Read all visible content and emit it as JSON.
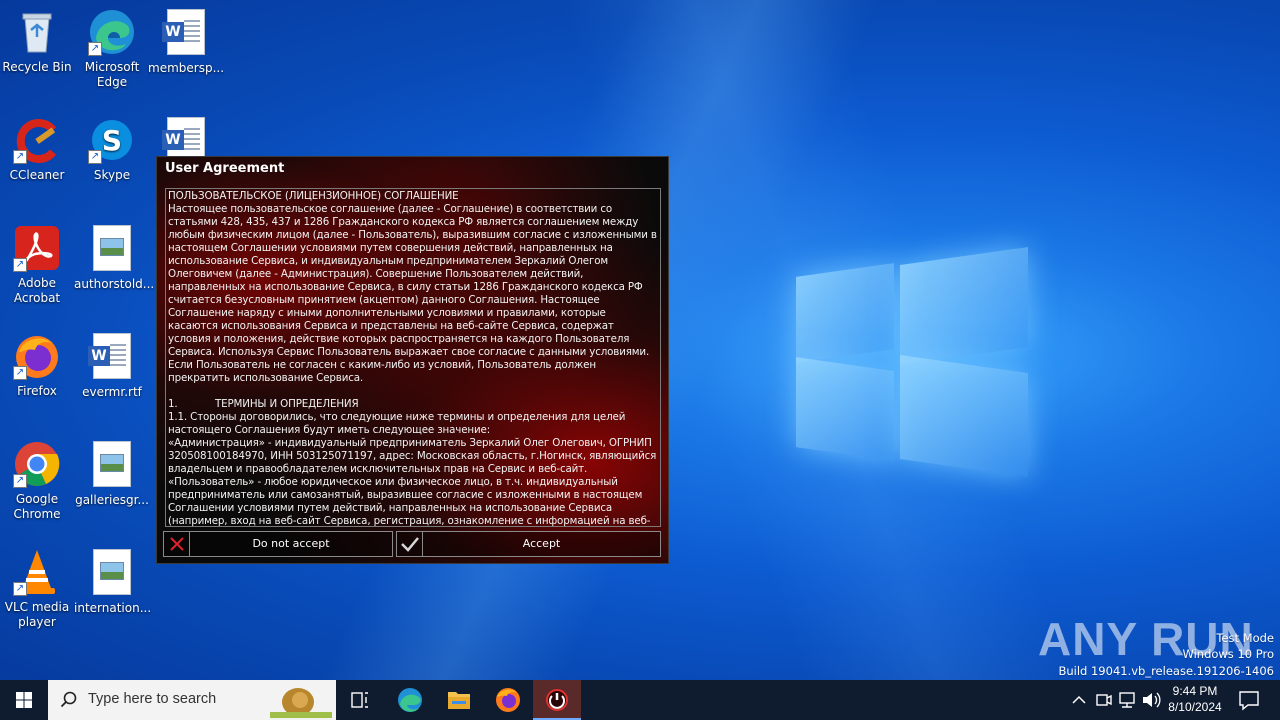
{
  "desktop": {
    "icons": [
      {
        "label": "Recycle Bin",
        "icon": "recycle-bin-icon"
      },
      {
        "label": "Microsoft Edge",
        "icon": "edge-icon"
      },
      {
        "label": "membersp...",
        "icon": "word-doc-icon"
      },
      {
        "label": "CCleaner",
        "icon": "ccleaner-icon"
      },
      {
        "label": "Skype",
        "icon": "skype-icon"
      },
      {
        "label": "Adobe Acrobat",
        "icon": "acrobat-icon"
      },
      {
        "label": "authorstold...",
        "icon": "image-file-icon"
      },
      {
        "label": "Firefox",
        "icon": "firefox-icon"
      },
      {
        "label": "evermr.rtf",
        "icon": "word-doc-icon"
      },
      {
        "label": "Google Chrome",
        "icon": "chrome-icon"
      },
      {
        "label": "galleriesgr...",
        "icon": "image-file-icon"
      },
      {
        "label": "VLC media player",
        "icon": "vlc-icon"
      },
      {
        "label": "internation...",
        "icon": "image-file-icon"
      }
    ]
  },
  "dialog": {
    "title": "User Agreement",
    "paragraphs": [
      "ПОЛЬЗОВАТЕЛЬСКОЕ (ЛИЦЕНЗИОННОЕ) СОГЛАШЕНИЕ",
      "Настоящее пользовательское соглашение (далее - Соглашение) в соответствии со статьями 428, 435, 437 и 1286 Гражданского кодекса РФ является соглашением между любым физическим лицом (далее - Пользователь), выразившим согласие с изложенными в настоящем Соглашении условиями путем совершения действий, направленных на использование Сервиса, и индивидуальным предпринимателем Зеркалий Олегом Олеговичем (далее - Администрация). Совершение Пользователем действий, направленных на использование Сервиса, в силу статьи 1286 Гражданского кодекса РФ считается безусловным принятием (акцептом) данного Соглашения. Настоящее Соглашение наряду с иными дополнительными условиями и правилами, которые касаются использования Сервиса и представлены на веб-сайте Сервиса, содержат условия и положения, действие которых распространяется на каждого Пользователя Сервиса. Используя Сервис Пользователь выражает свое согласие с данными условиями. Если Пользователь не согласен с каким-либо из условий, Пользователь должен прекратить использование Сервиса.",
      "",
      "1.            ТЕРМИНЫ И ОПРЕДЕЛЕНИЯ",
      "1.1. Стороны договорились, что следующие ниже термины и определения для целей настоящего Соглашения будут иметь следующее значение:",
      "«Администрация» - индивидуальный предприниматель Зеркалий Олег Олегович, ОГРНИП 320508100184970, ИНН 503125071197, адрес: Московская область, г.Ногинск, являющийся владельцем и правообладателем исключительных прав на Сервис и веб-сайт.",
      "«Пользователь» - любое юридическое или физическое лицо, в т.ч. индивидуальный предприниматель или самозанятый, выразившее согласие с изложенными в настоящем Соглашении условиями путем действий, направленных на использование Сервиса (например, вход на веб-сайт Сервиса, регистрация, ознакомление с информацией на веб-сайте Сервиса и т.п.)."
    ],
    "deny_label": "Do not accept",
    "accept_label": "Accept"
  },
  "watermark": {
    "brand": "ANY RUN",
    "line1": "Test Mode",
    "line2": "Windows 10 Pro",
    "line3": "Build 19041.vb_release.191206-1406"
  },
  "taskbar": {
    "search_placeholder": "Type here to search",
    "time": "9:44 PM",
    "date": "8/10/2024"
  },
  "colors": {
    "taskbar": "#0f1c2f",
    "dialog_bg": "#0a0a0a",
    "accent_red": "#c80000"
  }
}
